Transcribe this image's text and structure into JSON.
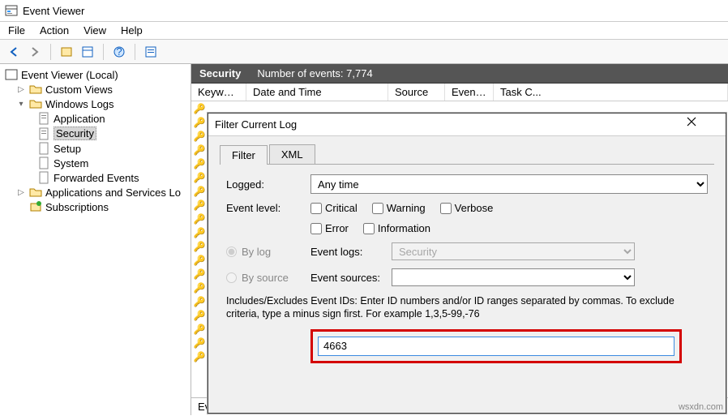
{
  "window": {
    "title": "Event Viewer"
  },
  "menubar": {
    "file": "File",
    "action": "Action",
    "view": "View",
    "help": "Help"
  },
  "tree": {
    "root": "Event Viewer (Local)",
    "custom_views": "Custom Views",
    "windows_logs": "Windows Logs",
    "logs": {
      "application": "Application",
      "security": "Security",
      "setup": "Setup",
      "system": "System",
      "forwarded": "Forwarded Events"
    },
    "app_services": "Applications and Services Lo",
    "subscriptions": "Subscriptions"
  },
  "security_header": {
    "title": "Security",
    "count_label": "Number of events:",
    "count_value": "7,774"
  },
  "columns": {
    "keywords": "Keywor...",
    "datetime": "Date and Time",
    "source": "Source",
    "event_id": "Event ID",
    "task": "Task C..."
  },
  "details_pane": "Eve",
  "dialog": {
    "title": "Filter Current Log",
    "tabs": {
      "filter": "Filter",
      "xml": "XML"
    },
    "logged_label": "Logged:",
    "logged_value": "Any time",
    "level_label": "Event level:",
    "levels": {
      "critical": "Critical",
      "warning": "Warning",
      "verbose": "Verbose",
      "error": "Error",
      "information": "Information"
    },
    "by_log": "By log",
    "by_source": "By source",
    "event_logs_label": "Event logs:",
    "event_logs_value": "Security",
    "event_sources_label": "Event sources:",
    "help_text": "Includes/Excludes Event IDs: Enter ID numbers and/or ID ranges separated by commas. To exclude criteria, type a minus sign first. For example 1,3,5-99,-76",
    "ids_value": "4663"
  },
  "watermark": "wsxdn.com"
}
